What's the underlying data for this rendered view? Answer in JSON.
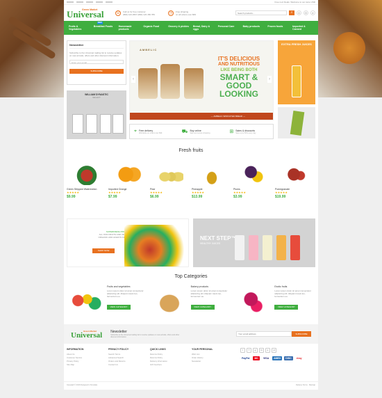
{
  "topbar": {
    "right_text": "Free next Deals: Welcome to our store",
    "currency": "USD"
  },
  "logo": {
    "sub": "Green Market",
    "main": "Universal"
  },
  "header": {
    "contact1_line1": "Call us for free customer",
    "contact1_line2": "(800) 123-4567 (800) 123 456 789",
    "contact2_line1": "Free shipping",
    "contact2_line2": "on all orders over $99",
    "search_placeholder": "Search products...",
    "cart_count": "0"
  },
  "nav": [
    {
      "label": "Fruits & Vegetables"
    },
    {
      "label": "Breakfast Foods",
      "badge": "NEW"
    },
    {
      "label": "Homemade products"
    },
    {
      "label": "Organic Food"
    },
    {
      "label": "Grocery & pickles"
    },
    {
      "label": "Bread, Dairy & eggs"
    },
    {
      "label": "Personal Care"
    },
    {
      "label": "Baby products"
    },
    {
      "label": "Frozen foods"
    },
    {
      "label": "Imported & Canned"
    }
  ],
  "sidebar": {
    "newsletter_title": "Newsletter",
    "newsletter_text": "Subscribe to the Universal mailing list to receive updates on new arrivals, offers and other discount information.",
    "email_placeholder": "Enter your email",
    "subscribe_label": "SUBSCRIBE",
    "banner_title": "WILLIAM DYNASTIC",
    "banner_sub": "SELECT"
  },
  "hero": {
    "brand": "AMBELIC",
    "line1": "IT'S DELICIOUS",
    "line2": "AND NUTRITIOUS",
    "line3": "LIKE BEING BOTH",
    "line4": "SMART &",
    "line5": "GOOD LOOKING",
    "bar_text": "— AMBELIC SPROUTED BREAD —"
  },
  "features": [
    {
      "title": "Free delivery",
      "sub": "Worldwide on orders over $99"
    },
    {
      "title": "Buy online",
      "sub": "Safe and secure shopping"
    },
    {
      "title": "Sales & discounts",
      "sub": "Save up to 50% every day"
    }
  ],
  "right_banner": {
    "title": "EXTRA FRESH JUICES"
  },
  "fresh_fruits": {
    "title": "Fresh fruits",
    "items": [
      {
        "name": "Green Stripped Watermelon",
        "stars": "★★★★★",
        "price": "$9.99"
      },
      {
        "name": "Imported Orange",
        "stars": "★★★★★",
        "price": "$7.99"
      },
      {
        "name": "Pear",
        "stars": "★★★★★",
        "price": "$6.99"
      },
      {
        "name": "Pineapple",
        "stars": "★★★★★",
        "price": "$13.99"
      },
      {
        "name": "Plums",
        "stars": "★★★★★",
        "price": "$3.99"
      },
      {
        "name": "Pomegranate",
        "stars": "★★★★★",
        "price": "$19.99"
      }
    ]
  },
  "promo1": {
    "kicker": "SUPERFRESH PRODUCTS",
    "text": "ALL OUR FRUITS AND VEGETABLES ARE ORGANIC AND ALWAYS FRESH AND JUICY",
    "btn": "SHOP NOW"
  },
  "promo2": {
    "title": "NEXT STEP™",
    "sub": "HEALTHY JUICES"
  },
  "top_categories": {
    "title": "Top Categories",
    "items": [
      {
        "name": "Fruits and vegetables",
        "desc": "Lorem ipsum dolor sit amet consectetur adipiscing elit. Aliquam turpis leo, fermentum eu.",
        "btn": "VIEW CATEGORY"
      },
      {
        "name": "Bakery products",
        "desc": "Lorem ipsum dolor sit amet consectetur adipiscing elit. Aliquam turpis leo, fermentum eu.",
        "btn": "VIEW CATEGORY"
      },
      {
        "name": "Exotic fruits",
        "desc": "Lorem ipsum dolor sit amet consectetur adipiscing elit. Aliquam turpis leo, fermentum eu.",
        "btn": "VIEW CATEGORY"
      }
    ]
  },
  "newsletter": {
    "title": "Newsletter",
    "text": "Subscribe to the Universal mailing list to receive updates on new arrivals, offers and other discount information.",
    "placeholder": "Your email address",
    "btn": "SUBSCRIBE"
  },
  "footer": {
    "cols": [
      {
        "title": "INFORMATION",
        "links": [
          "About Us",
          "Customer Service",
          "Privacy Policy",
          "Site Map"
        ]
      },
      {
        "title": "PRIVACY POLICY",
        "links": [
          "Search Terms",
          "Advanced Search",
          "Orders and Returns",
          "Contact Us"
        ]
      },
      {
        "title": "QUICK LINKS",
        "links": [
          "Returns Policy",
          "Returns Policy",
          "Delivery Information",
          "Gift Vouchers"
        ]
      },
      {
        "title": "YOUR PERSONAL",
        "links": [
          "Wish List",
          "Order History",
          "Newsletter"
        ]
      }
    ],
    "social": [
      "t",
      "f",
      "g",
      "in",
      "p",
      "yt"
    ],
    "payments": [
      "PayPal",
      "MC",
      "VISA",
      "AMEX",
      "DISC",
      "ebay"
    ],
    "copyright": "Copyright © 2016 Designed in Template",
    "bottom_right": "Delivery Terms · Sitemap"
  }
}
